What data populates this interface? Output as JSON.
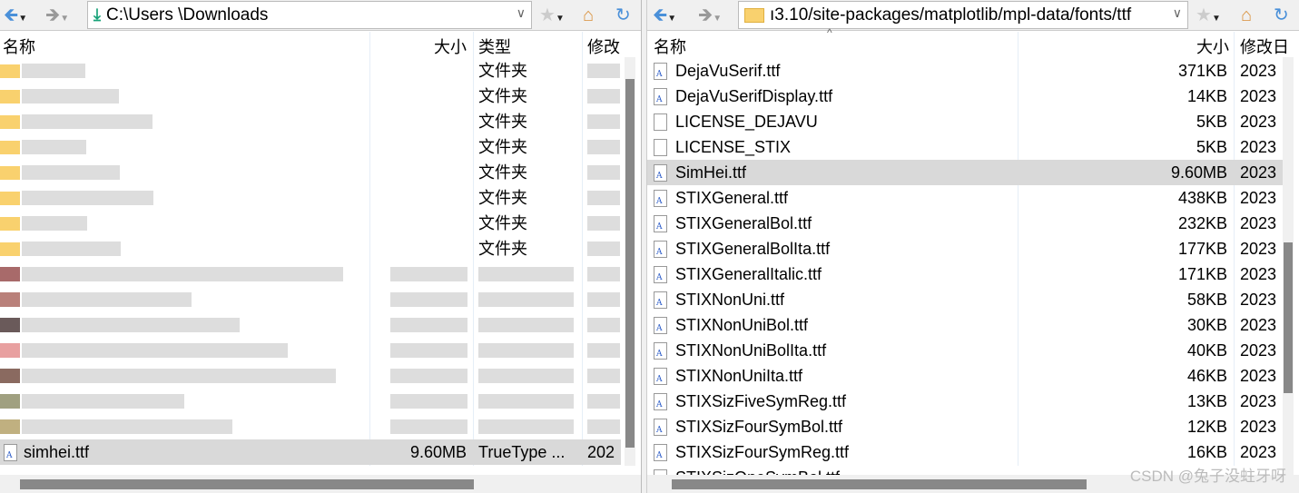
{
  "left": {
    "address": "C:\\Users     \\Downloads",
    "columns": {
      "name": "名称",
      "size": "大小",
      "type": "类型",
      "modified": "修改"
    },
    "folder_type": "文件夹",
    "folder_count": 8,
    "selected": {
      "name": "simhei.ttf",
      "size": "9.60MB",
      "type": "TrueType ...",
      "modified": "202"
    }
  },
  "right": {
    "address": "ı3.10/site-packages/matplotlib/mpl-data/fonts/ttf",
    "columns": {
      "name": "名称",
      "size": "大小",
      "modified": "修改日"
    },
    "files": [
      {
        "name": "DejaVuSerif.ttf",
        "size": "371KB",
        "modified": "2023",
        "icon": "font"
      },
      {
        "name": "DejaVuSerifDisplay.ttf",
        "size": "14KB",
        "modified": "2023",
        "icon": "font"
      },
      {
        "name": "LICENSE_DEJAVU",
        "size": "5KB",
        "modified": "2023",
        "icon": "file"
      },
      {
        "name": "LICENSE_STIX",
        "size": "5KB",
        "modified": "2023",
        "icon": "file"
      },
      {
        "name": "SimHei.ttf",
        "size": "9.60MB",
        "modified": "2023",
        "icon": "font",
        "selected": true
      },
      {
        "name": "STIXGeneral.ttf",
        "size": "438KB",
        "modified": "2023",
        "icon": "font"
      },
      {
        "name": "STIXGeneralBol.ttf",
        "size": "232KB",
        "modified": "2023",
        "icon": "font"
      },
      {
        "name": "STIXGeneralBolIta.ttf",
        "size": "177KB",
        "modified": "2023",
        "icon": "font"
      },
      {
        "name": "STIXGeneralItalic.ttf",
        "size": "171KB",
        "modified": "2023",
        "icon": "font"
      },
      {
        "name": "STIXNonUni.ttf",
        "size": "58KB",
        "modified": "2023",
        "icon": "font"
      },
      {
        "name": "STIXNonUniBol.ttf",
        "size": "30KB",
        "modified": "2023",
        "icon": "font"
      },
      {
        "name": "STIXNonUniBolIta.ttf",
        "size": "40KB",
        "modified": "2023",
        "icon": "font"
      },
      {
        "name": "STIXNonUniIta.ttf",
        "size": "46KB",
        "modified": "2023",
        "icon": "font"
      },
      {
        "name": "STIXSizFiveSymReg.ttf",
        "size": "13KB",
        "modified": "2023",
        "icon": "font"
      },
      {
        "name": "STIXSizFourSymBol.ttf",
        "size": "12KB",
        "modified": "2023",
        "icon": "font"
      },
      {
        "name": "STIXSizFourSymReg.ttf",
        "size": "16KB",
        "modified": "2023",
        "icon": "font"
      },
      {
        "name": "STIXSizOneSymBol.ttf",
        "size": "",
        "modified": "",
        "icon": "font"
      }
    ]
  },
  "watermark": "CSDN @兔子没蛀牙呀",
  "colors": {
    "selection": "#d9d9d9",
    "back_arrow": "#4a90d9",
    "download_icon": "#1aa37a",
    "folder": "#f9d16e"
  }
}
